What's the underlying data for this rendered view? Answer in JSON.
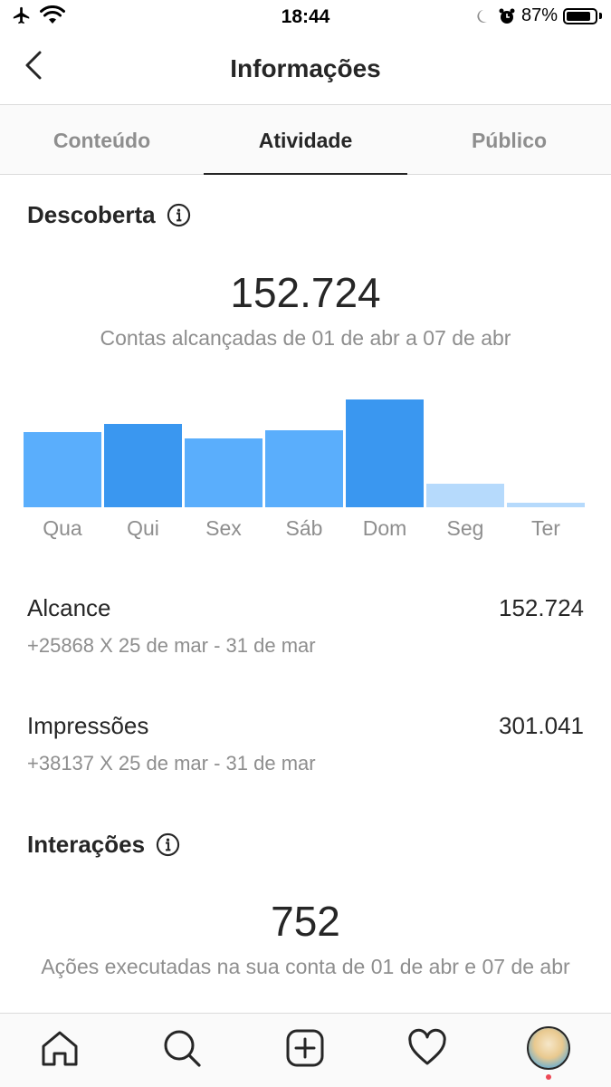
{
  "status_bar": {
    "time": "18:44",
    "battery_text": "87%",
    "battery_level": 0.87
  },
  "header": {
    "title": "Informações"
  },
  "tabs": [
    {
      "label": "Conteúdo",
      "active": false
    },
    {
      "label": "Atividade",
      "active": true
    },
    {
      "label": "Público",
      "active": false
    }
  ],
  "discovery": {
    "title": "Descoberta",
    "total": "152.724",
    "caption": "Contas alcançadas de 01 de abr a 07 de abr"
  },
  "chart_data": {
    "type": "bar",
    "categories": [
      "Qua",
      "Qui",
      "Sex",
      "Sáb",
      "Dom",
      "Seg",
      "Ter"
    ],
    "values": [
      70,
      78,
      64,
      72,
      101,
      22,
      4
    ],
    "ylim": [
      0,
      110
    ],
    "colors": [
      "#5aaefc",
      "#3a97f0",
      "#5aaefc",
      "#5aaefc",
      "#3a97f0",
      "#b6dafc",
      "#b6dafc"
    ],
    "grid": false,
    "legend": "none"
  },
  "metrics": {
    "reach": {
      "label": "Alcance",
      "value": "152.724",
      "comparison": "+25868 X 25 de mar - 31 de mar"
    },
    "impressions": {
      "label": "Impressões",
      "value": "301.041",
      "comparison": "+38137 X 25 de mar - 31 de mar"
    }
  },
  "interactions": {
    "title": "Interações",
    "total": "752",
    "caption": "Ações executadas na sua conta de 01 de abr e 07 de abr"
  },
  "bottom_nav": {
    "items": [
      "home-icon",
      "search-icon",
      "add-post-icon",
      "activity-heart-icon",
      "profile-avatar"
    ],
    "notification_color": "#ed4956"
  }
}
